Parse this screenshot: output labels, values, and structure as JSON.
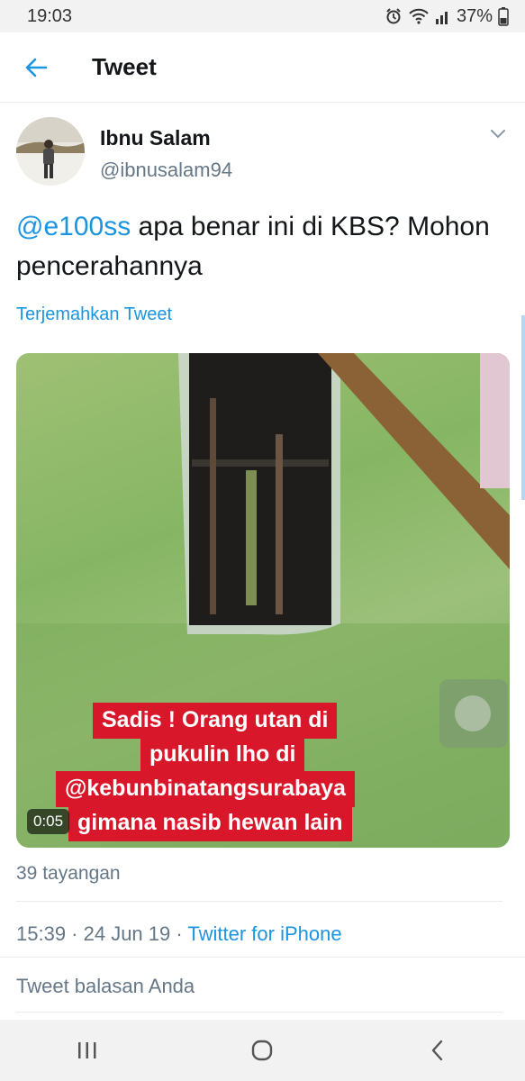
{
  "status_bar": {
    "time": "19:03",
    "battery": "37%",
    "icons": [
      "alarm-icon",
      "wifi-icon",
      "signal-icon",
      "battery-icon"
    ]
  },
  "header": {
    "title": "Tweet",
    "back_icon": "back-arrow-icon"
  },
  "tweet": {
    "author_name": "Ibnu Salam",
    "author_handle": "@ibnusalam94",
    "mention": "@e100ss",
    "text_after_mention": " apa benar ini di KBS? Mohon pencerahannya",
    "translate_label": "Terjemahkan Tweet",
    "media": {
      "caption_lines": [
        "Sadis ! Orang utan di",
        "pukulin lho di",
        "@kebunbinatangsurabaya",
        "gimana nasib hewan lain"
      ],
      "duration": "0:05"
    },
    "views": "39 tayangan",
    "timestamp": "15:39 · 24 Jun 19 · ",
    "source": "Twitter for iPhone",
    "reply_placeholder": "Tweet balasan Anda"
  },
  "nav": {
    "icons": [
      "recent-apps-icon",
      "home-icon",
      "back-icon"
    ]
  },
  "colors": {
    "accent": "#1b95e0",
    "caption_red": "#d8182a",
    "secondary_text": "#657786"
  }
}
